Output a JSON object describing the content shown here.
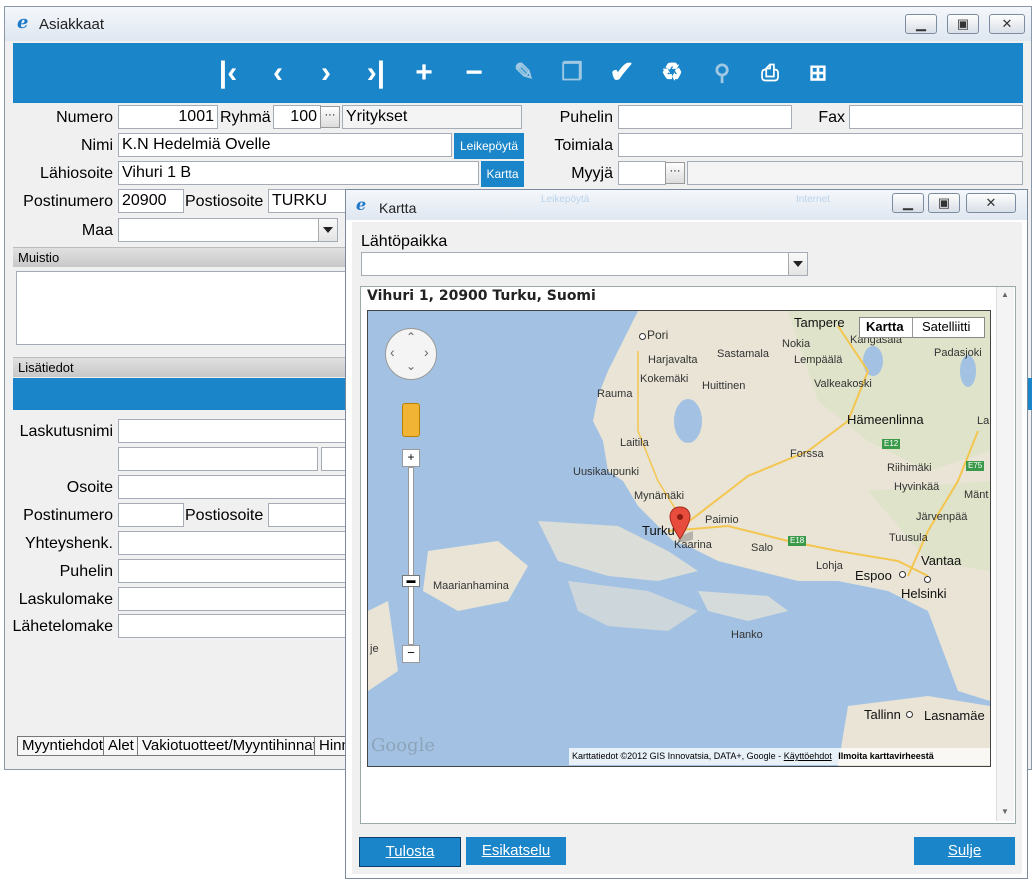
{
  "main_window": {
    "title": "Asiakkaat",
    "form": {
      "numero_label": "Numero",
      "numero_value": "1001",
      "ryhma_label": "Ryhmä",
      "ryhma_value": "100",
      "ryhma_name": "Yritykset",
      "nimi_label": "Nimi",
      "nimi_value": "K.N Hedelmiä Ovelle",
      "leikepoyta_label": "Leikepöytä",
      "lahiosoite_label": "Lähiosoite",
      "lahiosoite_value": "Vihuri 1 B",
      "kartta_label": "Kartta",
      "postinumero_label": "Postinumero",
      "postinumero_value": "20900",
      "postiosoite_label": "Postiosoite",
      "postiosoite_value": "TURKU",
      "maa_label": "Maa",
      "puhelin_label": "Puhelin",
      "fax_label": "Fax",
      "toimiala_label": "Toimiala",
      "myyja_label": "Myyjä",
      "ellipsis": "···"
    },
    "sections": {
      "muistio": "Muistio",
      "lisatiedot": "Lisätiedot"
    },
    "lisatiedot": {
      "laskutusnimi": "Laskutusnimi",
      "osoite": "Osoite",
      "postinumero": "Postinumero",
      "postiosoite": "Postiosoite",
      "yhteyshenk": "Yhteyshenk.",
      "puhelin": "Puhelin",
      "laskulomake": "Laskulomake",
      "lahetelomake": "Lähetelomake"
    },
    "tabs": [
      "Myyntiehdot",
      "Alet",
      "Vakiotuotteet/Myyntihinnat",
      "Hinn"
    ]
  },
  "map_window": {
    "title": "Kartta",
    "lahtopaikka_label": "Lähtöpaikka",
    "address": "Vihuri 1, 20900 Turku, Suomi",
    "map_type_tabs": [
      "Kartta",
      "Satelliitti"
    ],
    "google_logo": "Google",
    "attribution": "Karttatiedot ©2012 GIS Innovatsia, DATA+, Google -",
    "terms_link": "Käyttöehdot",
    "report_link": "Ilmoita karttavirheestä",
    "cities": {
      "pori": "Pori",
      "tampere": "Tampere",
      "nokia": "Nokia",
      "kangasala": "Kangasala",
      "harjavalta": "Harjavalta",
      "sastamala": "Sastamala",
      "lempaala": "Lempäälä",
      "padasjoki": "Padasjoki",
      "kokemaki": "Kokemäki",
      "huittinen": "Huittinen",
      "valkeakoski": "Valkeakoski",
      "rauma": "Rauma",
      "hameenlinna": "Hämeenlinna",
      "laitila": "Laitila",
      "forssa": "Forssa",
      "riihimaki": "Riihimäki",
      "uusikaupunki": "Uusikaupunki",
      "hyvinkaa": "Hyvinkää",
      "mynamaki": "Mynämäki",
      "mantsala": "Mänt",
      "paimio": "Paimio",
      "jarvenpaa": "Järvenpää",
      "turku": "Turku",
      "kaarina": "Kaarina",
      "salo": "Salo",
      "tuusula": "Tuusula",
      "vantaa": "Vantaa",
      "lohja": "Lohja",
      "espoo": "Espoo",
      "helsinki": "Helsinki",
      "maarianhamina": "Maarianhamina",
      "hanko": "Hanko",
      "tallinn": "Tallinn",
      "lasnamae": "Lasnamäe",
      "la": "La",
      "je": "je"
    },
    "roads": {
      "e12": "E12",
      "e75": "E75",
      "e18": "E18"
    },
    "buttons": {
      "tulosta": "Tulosta",
      "esikatselu": "Esikatselu",
      "sulje": "Sulje"
    },
    "bg_hint_1": "Leikepöytä",
    "bg_hint_2": "Internet"
  }
}
